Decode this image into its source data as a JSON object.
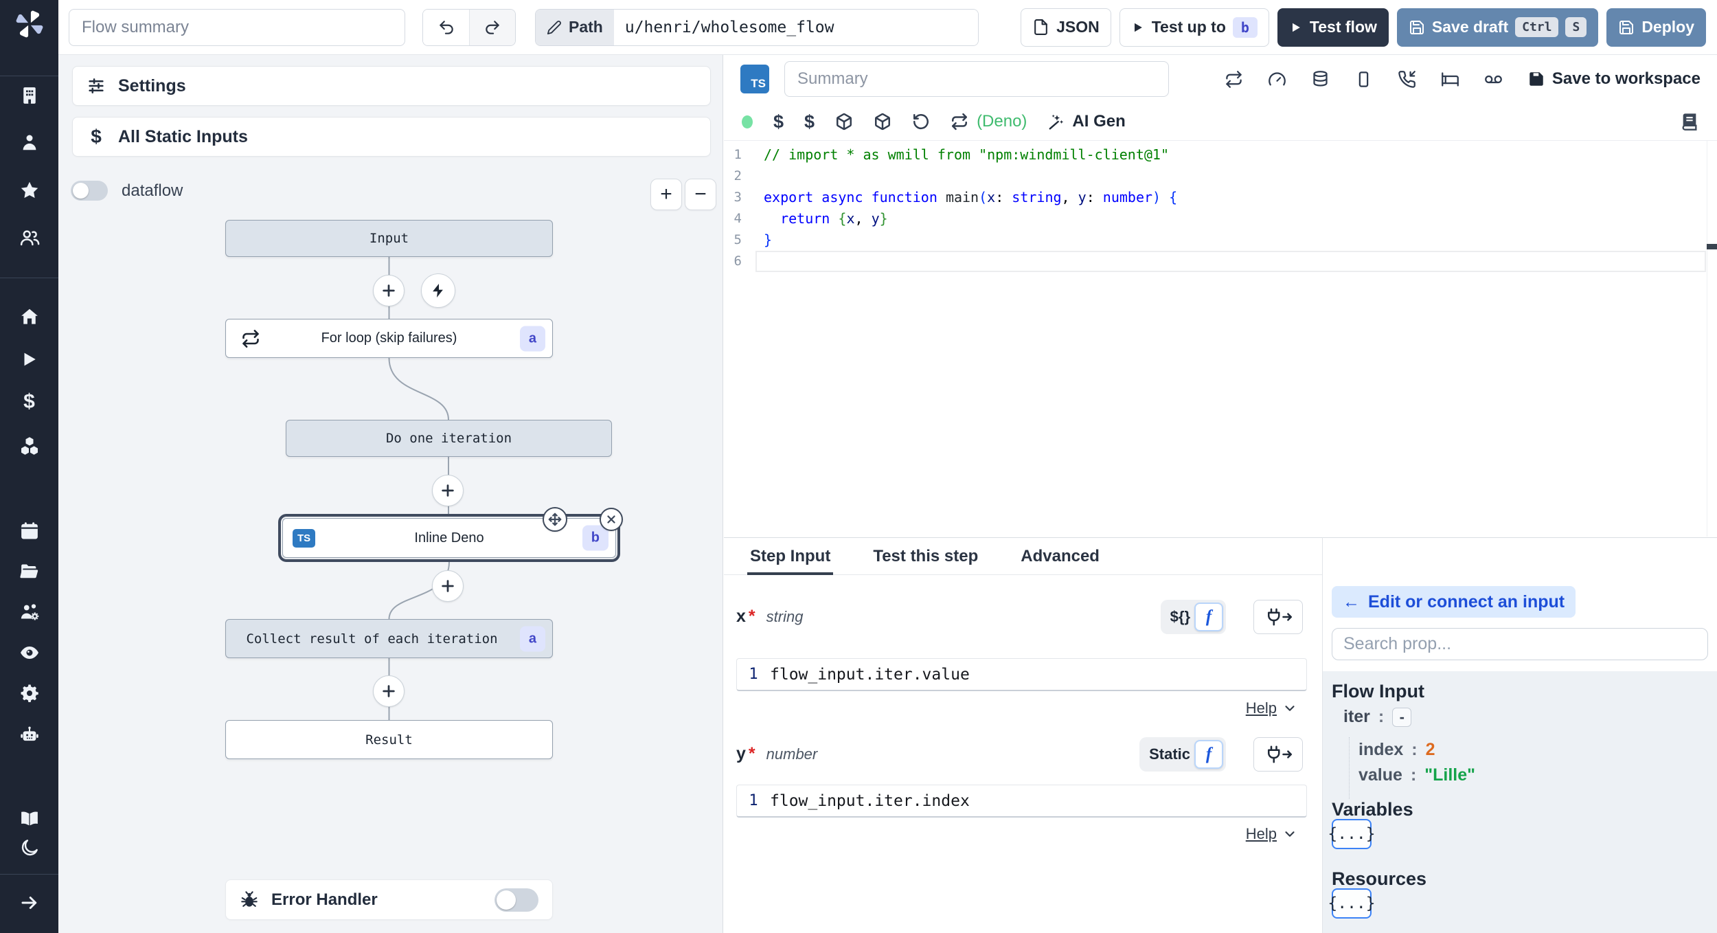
{
  "topbar": {
    "flow_summary_placeholder": "Flow summary",
    "path_label": "Path",
    "path_value": "u/henri/wholesome_flow",
    "json_button": "JSON",
    "test_up_to_label": "Test up to",
    "test_up_to_badge": "b",
    "test_flow_label": "Test flow",
    "save_draft_label": "Save draft",
    "kbd_ctrl": "Ctrl",
    "kbd_s": "S",
    "deploy_label": "Deploy"
  },
  "sidebar": {
    "icons": [
      "windmill-logo",
      "building",
      "user",
      "star",
      "users",
      "home",
      "play",
      "dollar",
      "boxes",
      "calendar",
      "folder-open",
      "users-settings",
      "eye",
      "settings-gear",
      "bot",
      "library",
      "moon",
      "arrow-right"
    ]
  },
  "flow": {
    "settings_label": "Settings",
    "static_inputs_label": "All Static Inputs",
    "dataflow_label": "dataflow",
    "zoom_in": "+",
    "zoom_out": "−",
    "nodes": {
      "input": "Input",
      "for_loop": "For loop (skip failures)",
      "for_loop_badge": "a",
      "do_one": "Do one iteration",
      "inline_deno": "Inline Deno",
      "inline_deno_badge": "b",
      "inline_deno_lang": "TS",
      "collect": "Collect result of each iteration",
      "collect_badge": "a",
      "result": "Result"
    },
    "error_handler_label": "Error Handler"
  },
  "editor": {
    "lang_badge": "TS",
    "summary_placeholder": "Summary",
    "header_icons": [
      "repeat",
      "gauge",
      "database",
      "smartphone",
      "phone-incoming",
      "bed",
      "voicemail"
    ],
    "save_to_workspace": "Save to workspace",
    "runtime_label": "(Deno)",
    "ai_gen_label": "AI Gen",
    "code": {
      "current_line": 6,
      "lines": [
        {
          "tokens": [
            {
              "c": "comment",
              "t": "// import * as wmill from \"npm:windmill-client@1\""
            }
          ]
        },
        {
          "tokens": []
        },
        {
          "tokens": [
            {
              "c": "kw",
              "t": "export"
            },
            {
              "c": "pl",
              "t": " "
            },
            {
              "c": "kw",
              "t": "async"
            },
            {
              "c": "pl",
              "t": " "
            },
            {
              "c": "kw",
              "t": "function"
            },
            {
              "c": "pl",
              "t": " "
            },
            {
              "c": "fn",
              "t": "main"
            },
            {
              "c": "b1",
              "t": "("
            },
            {
              "c": "var",
              "t": "x"
            },
            {
              "c": "pl",
              "t": ": "
            },
            {
              "c": "kw",
              "t": "string"
            },
            {
              "c": "pl",
              "t": ", "
            },
            {
              "c": "var",
              "t": "y"
            },
            {
              "c": "pl",
              "t": ": "
            },
            {
              "c": "kw",
              "t": "number"
            },
            {
              "c": "b1",
              "t": ")"
            },
            {
              "c": "pl",
              "t": " "
            },
            {
              "c": "b1",
              "t": "{"
            }
          ]
        },
        {
          "tokens": [
            {
              "c": "pl",
              "t": "  "
            },
            {
              "c": "kw",
              "t": "return"
            },
            {
              "c": "pl",
              "t": " "
            },
            {
              "c": "b2",
              "t": "{"
            },
            {
              "c": "var",
              "t": "x"
            },
            {
              "c": "pl",
              "t": ", "
            },
            {
              "c": "var",
              "t": "y"
            },
            {
              "c": "b2",
              "t": "}"
            }
          ]
        },
        {
          "tokens": [
            {
              "c": "b1",
              "t": "}"
            }
          ]
        },
        {
          "tokens": []
        }
      ]
    }
  },
  "step": {
    "tabs": [
      "Step Input",
      "Test this step",
      "Advanced"
    ],
    "active_tab": "Step Input",
    "fields": [
      {
        "name": "x",
        "req": "*",
        "type": "string",
        "mode": "${}",
        "expr": "flow_input.iter.value",
        "ln": "1",
        "help": "Help"
      },
      {
        "name": "y",
        "req": "*",
        "type": "number",
        "mode": "Static",
        "expr": "flow_input.iter.index",
        "ln": "1",
        "help": "Help"
      }
    ]
  },
  "connect": {
    "back_arrow": "←",
    "back_label": "Edit or connect an input",
    "search_placeholder": "Search prop...",
    "flow_input_title": "Flow Input",
    "iter_label": "iter",
    "iter_collapse": "-",
    "index_label": "index",
    "index_value": "2",
    "value_label": "value",
    "value_value": "\"Lille\"",
    "variables_title": "Variables",
    "variables_button": "{...}",
    "resources_title": "Resources",
    "resources_button": "{...}"
  },
  "colors": {
    "sidebar_bg": "#1e2533",
    "steel_blue": "#6487ae",
    "dark_button": "#2b3547",
    "ts_badge_blue": "#2e7ac2",
    "badge_bg": "#dfe4fd",
    "badge_text": "#4146c8",
    "deno_green": "#3fbb6e",
    "status_dot_green": "#77e2a4",
    "chip_bg": "#dbeafe",
    "chip_text": "#1d4ed8",
    "value_green": "#15a34a",
    "index_orange": "#dd6b20"
  }
}
